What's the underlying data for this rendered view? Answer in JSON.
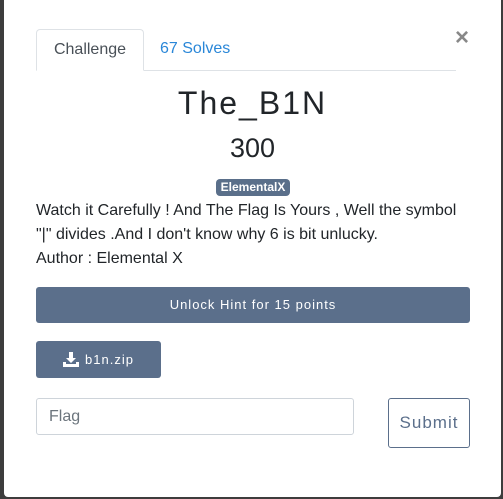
{
  "modal": {
    "close_symbol": "×",
    "tabs": [
      {
        "label": "Challenge"
      },
      {
        "label": "67 Solves"
      }
    ],
    "challenge": {
      "name": "The_B1N",
      "points": "300",
      "tag": "ElementalX",
      "description_line1": "Watch it Carefully ! And The Flag Is Yours , Well the symbol",
      "description_line2": "\"|\" divides .And I don't know why 6 is bit unlucky.",
      "description_line3": "Author : Elemental X"
    },
    "hint_button": "Unlock Hint for 15 points",
    "file_button": "b1n.zip",
    "flag_input": {
      "placeholder": "Flag",
      "value": ""
    },
    "submit_button": "Submit"
  },
  "colors": {
    "accent": "#5b6f8b",
    "link": "#2a87d8",
    "backdrop": "#3d3d3d"
  },
  "icons": {
    "close": "close-icon",
    "download": "download-icon"
  }
}
